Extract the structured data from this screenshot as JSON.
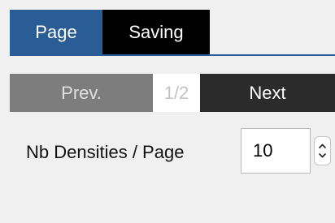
{
  "tabs": [
    {
      "label": "Page",
      "active": true
    },
    {
      "label": "Saving",
      "active": false
    }
  ],
  "pager": {
    "prev_label": "Prev.",
    "page_indicator": "1/2",
    "next_label": "Next"
  },
  "settings": {
    "nb_densities_label": "Nb Densities / Page",
    "nb_densities_value": "10",
    "stepper_icon": "up-down-stepper-icon"
  },
  "colors": {
    "active_tab": "#2a5c95",
    "inactive_tab": "#000000",
    "prev_disabled": "#7d7d7d",
    "next": "#2b2b2b",
    "background": "#f0f0f0"
  }
}
